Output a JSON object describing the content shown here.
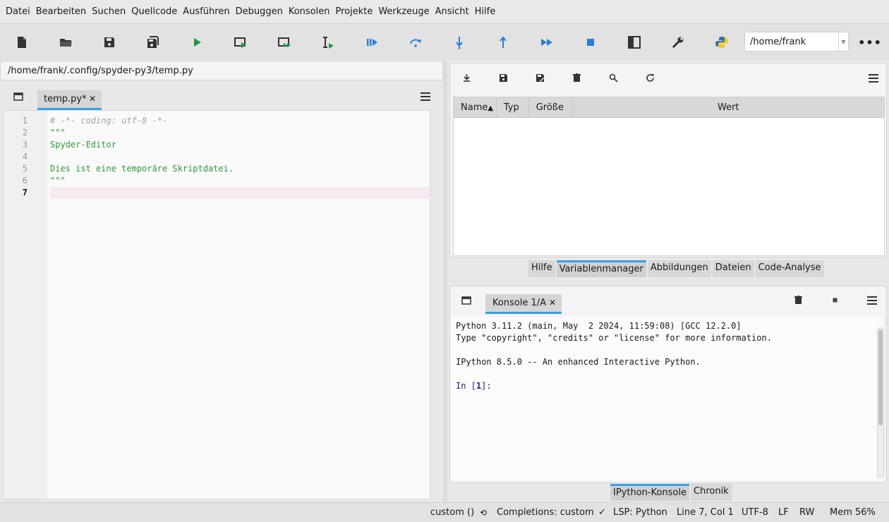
{
  "menu": [
    "Datei",
    "Bearbeiten",
    "Suchen",
    "Quellcode",
    "Ausführen",
    "Debuggen",
    "Konsolen",
    "Projekte",
    "Werkzeuge",
    "Ansicht",
    "Hilfe"
  ],
  "toolbar": {
    "working_dir": "/home/frank",
    "icons": [
      "new-file-icon",
      "open-folder-icon",
      "save-icon",
      "save-all-icon",
      "run-icon",
      "run-cell-icon",
      "run-cell-advance-icon",
      "run-selection-icon",
      "debug-icon",
      "step-over-icon",
      "step-into-icon",
      "step-return-icon",
      "continue-icon",
      "stop-icon",
      "maximize-pane-icon",
      "preferences-icon",
      "python-path-icon"
    ],
    "accent": "#2a9fd6",
    "run_color": "#27a04a"
  },
  "editor": {
    "path": "/home/frank/.config/spyder-py3/temp.py",
    "tab_label": "temp.py*",
    "tab_close": "✕",
    "current_line": 7,
    "lines": [
      {
        "n": "1",
        "text": "# -*- coding: utf-8 -*-",
        "kind": "comment"
      },
      {
        "n": "2",
        "text": "\"\"\"",
        "kind": "string"
      },
      {
        "n": "3",
        "text": "Spyder-Editor",
        "kind": "string"
      },
      {
        "n": "4",
        "text": "",
        "kind": "string"
      },
      {
        "n": "5",
        "text": "Dies ist eine temporäre Skriptdatei.",
        "kind": "string"
      },
      {
        "n": "6",
        "text": "\"\"\"",
        "kind": "string"
      },
      {
        "n": "7",
        "text": "",
        "kind": "plain"
      }
    ]
  },
  "variables": {
    "columns": [
      "Name",
      "Typ",
      "Größe",
      "Wert"
    ],
    "sort_arrow": "▲",
    "rows": []
  },
  "top_tabs": [
    {
      "label": "Hilfe",
      "active": false
    },
    {
      "label": "Variablenmanager",
      "active": true
    },
    {
      "label": "Abbildungen",
      "active": false
    },
    {
      "label": "Dateien",
      "active": false
    },
    {
      "label": "Code-Analyse",
      "active": false
    }
  ],
  "console": {
    "tab_label": "Konsole 1/A",
    "tab_close": "✕",
    "lines": [
      "Python 3.11.2 (main, May  2 2024, 11:59:08) [GCC 12.2.0]",
      "Type \"copyright\", \"credits\" or \"license\" for more information.",
      "",
      "IPython 8.5.0 -- An enhanced Interactive Python.",
      ""
    ],
    "prompt_in": "In [",
    "prompt_num": "1",
    "prompt_end": "]:"
  },
  "bottom_tabs": [
    {
      "label": "IPython-Konsole",
      "active": true
    },
    {
      "label": "Chronik",
      "active": false
    }
  ],
  "status": {
    "env": "custom ()",
    "completions": "Completions: custom",
    "lsp": "LSP: Python",
    "position": "Line 7, Col 1",
    "encoding": "UTF-8",
    "eol": "LF",
    "mode": "RW",
    "memory": "Mem 56%"
  }
}
